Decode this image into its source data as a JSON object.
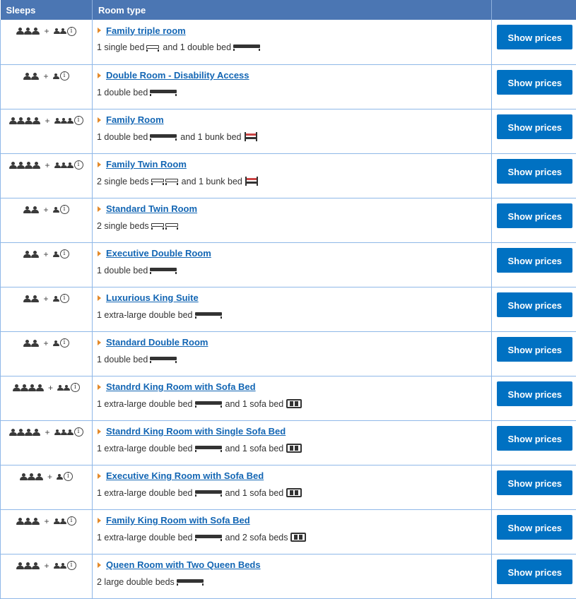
{
  "header": {
    "sleeps": "Sleeps",
    "room_type": "Room type",
    "action": ""
  },
  "button_label": "Show prices",
  "rooms": [
    {
      "adults": 3,
      "children": 2,
      "name": "Family triple room",
      "beds": [
        {
          "t": "1 single bed",
          "icons": [
            "single"
          ]
        },
        {
          "t": "and 1 double bed",
          "icons": [
            "double"
          ]
        }
      ]
    },
    {
      "adults": 2,
      "children": 1,
      "name": "Double Room - Disability Access",
      "beds": [
        {
          "t": "1 double bed",
          "icons": [
            "double"
          ]
        }
      ]
    },
    {
      "adults": 4,
      "children": 3,
      "name": "Family Room",
      "beds": [
        {
          "t": "1 double bed",
          "icons": [
            "double"
          ]
        },
        {
          "t": "and 1 bunk bed",
          "icons": [
            "bunk"
          ]
        }
      ]
    },
    {
      "adults": 4,
      "children": 3,
      "name": "Family Twin Room",
      "beds": [
        {
          "t": "2 single beds",
          "icons": [
            "single",
            "single"
          ]
        },
        {
          "t": "and 1 bunk bed",
          "icons": [
            "bunk"
          ]
        }
      ]
    },
    {
      "adults": 2,
      "children": 1,
      "name": "Standard Twin Room",
      "beds": [
        {
          "t": "2 single beds",
          "icons": [
            "single",
            "single"
          ]
        }
      ]
    },
    {
      "adults": 2,
      "children": 1,
      "name": "Executive Double Room",
      "beds": [
        {
          "t": "1 double bed",
          "icons": [
            "double"
          ]
        }
      ]
    },
    {
      "adults": 2,
      "children": 1,
      "name": "Luxurious King Suite",
      "beds": [
        {
          "t": "1 extra-large double bed",
          "icons": [
            "xl"
          ]
        }
      ]
    },
    {
      "adults": 2,
      "children": 1,
      "name": "Standard Double Room",
      "beds": [
        {
          "t": "1 double bed",
          "icons": [
            "double"
          ]
        }
      ]
    },
    {
      "adults": 4,
      "children": 2,
      "name": "Standrd King Room with Sofa Bed",
      "beds": [
        {
          "t": "1 extra-large double bed",
          "icons": [
            "xl"
          ]
        },
        {
          "t": "and 1 sofa bed",
          "icons": [
            "sofa"
          ]
        }
      ]
    },
    {
      "adults": 4,
      "children": 3,
      "name": "Standrd King Room with Single Sofa Bed",
      "beds": [
        {
          "t": "1 extra-large double bed",
          "icons": [
            "xl"
          ]
        },
        {
          "t": "and 1 sofa bed",
          "icons": [
            "sofa"
          ]
        }
      ]
    },
    {
      "adults": 3,
      "children": 1,
      "name": "Executive King Room with Sofa Bed",
      "beds": [
        {
          "t": "1 extra-large double bed",
          "icons": [
            "xl"
          ]
        },
        {
          "t": "and 1 sofa bed",
          "icons": [
            "sofa"
          ]
        }
      ]
    },
    {
      "adults": 3,
      "children": 2,
      "name": "Family King Room with Sofa Bed",
      "beds": [
        {
          "t": "1 extra-large double bed",
          "icons": [
            "xl"
          ]
        },
        {
          "t": "and 2 sofa beds",
          "icons": [
            "sofa"
          ]
        }
      ]
    },
    {
      "adults": 3,
      "children": 2,
      "name": "Queen Room with Two Queen Beds",
      "beds": [
        {
          "t": "2 large double beds",
          "icons": [
            "double"
          ]
        }
      ]
    }
  ],
  "icons": {
    "person": "person-icon",
    "info": "info-icon",
    "arrow": "arrow-right-icon"
  },
  "colors": {
    "header_bg": "#4b76b3",
    "link": "#1366b4",
    "button": "#0071c2",
    "arrow": "#e48a2a",
    "border": "#8fb8e8"
  }
}
